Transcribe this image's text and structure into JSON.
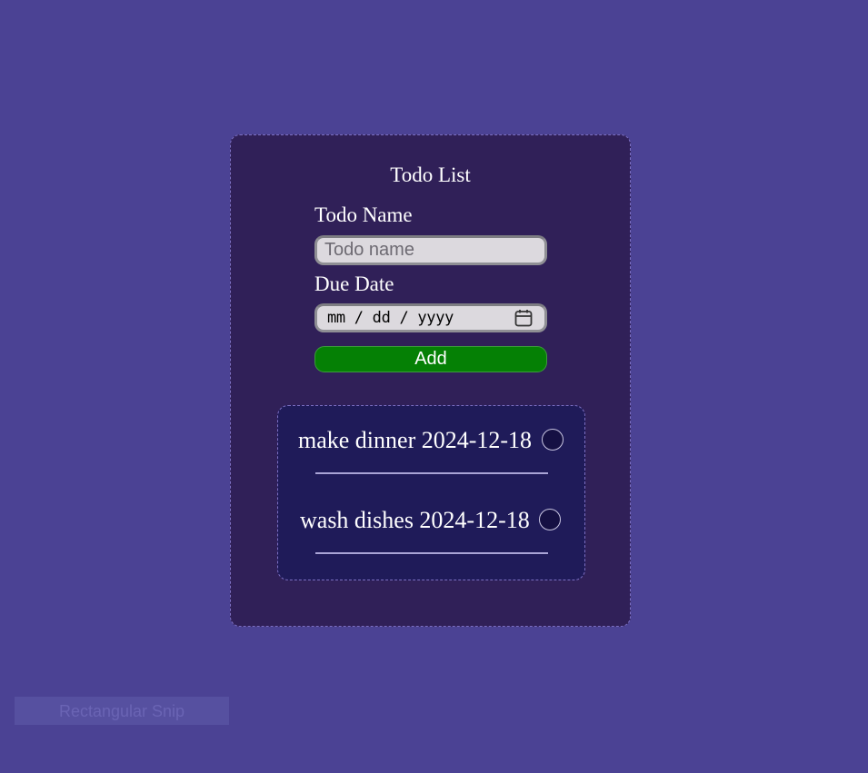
{
  "app": {
    "title": "Todo List"
  },
  "form": {
    "name_label": "Todo Name",
    "name_value": "",
    "name_placeholder": "Todo name",
    "date_label": "Due Date",
    "date_placeholder": "mm / dd / yyyy",
    "date_icon": "calendar-icon",
    "add_label": "Add"
  },
  "todos": [
    {
      "text": "make dinner 2024-12-18",
      "done": false
    },
    {
      "text": "wash dishes 2024-12-18",
      "done": false
    }
  ],
  "overlay": {
    "snip_label": "Rectangular Snip"
  },
  "colors": {
    "page_background": "#4b4294",
    "card_background": "#302058",
    "list_background": "#1f1b59",
    "add_button": "#058005",
    "text": "#ffffff"
  }
}
